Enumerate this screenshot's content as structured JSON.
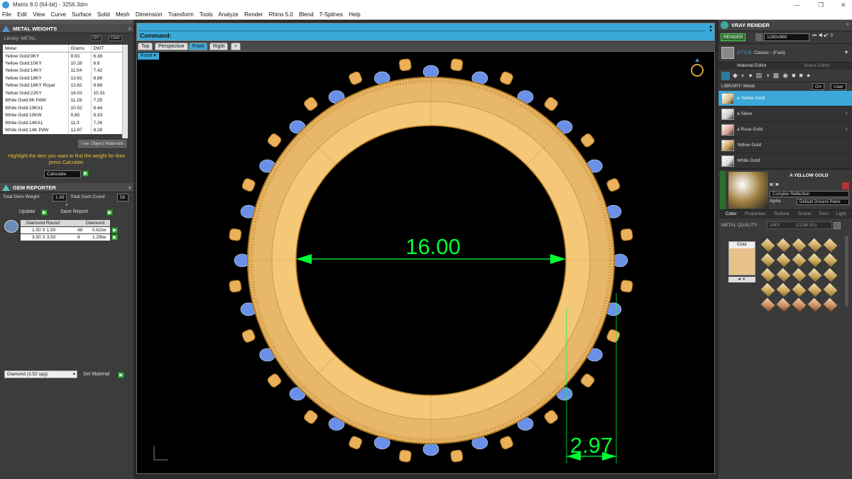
{
  "window": {
    "title": "Matrix 8.0 (64-bit) - 3256.3dm"
  },
  "menu": [
    "File",
    "Edit",
    "View",
    "Curve",
    "Surface",
    "Solid",
    "Mesh",
    "Dimension",
    "Transform",
    "Tools",
    "Analyze",
    "Render",
    "Rhino 5.0",
    "Blend",
    "T-Splines",
    "Help"
  ],
  "metal_weights": {
    "title": "METAL WEIGHTS",
    "library": "Library: METAL",
    "gv": "GV",
    "user": "User",
    "columns": [
      "Metal",
      "Grams",
      "DWT"
    ],
    "rows": [
      [
        "Yellow Gold:9KY",
        "9.93",
        "6.38"
      ],
      [
        "Yellow Gold:10KY",
        "10.26",
        "6.6"
      ],
      [
        "Yellow Gold:14KY",
        "11.54",
        "7.42"
      ],
      [
        "Yellow Gold:18KY",
        "13.81",
        "8.88"
      ],
      [
        "Yellow Gold:18KY Royal",
        "13.81",
        "8.88"
      ],
      [
        "Yellow Gold:22KY",
        "16.03",
        "10.31"
      ],
      [
        "White Gold:9K PdW",
        "11.28",
        "7.25"
      ],
      [
        "White Gold:10KX1",
        "10.02",
        "6.44"
      ],
      [
        "White Gold:10KW",
        "9.85",
        "6.33"
      ],
      [
        "White Gold:14KX1",
        "11.3",
        "7.26"
      ],
      [
        "White Gold:14K PdW",
        "12.87",
        "8.28"
      ]
    ],
    "use_object_materials": "Use Object Materials",
    "hint": "Highlight the item you want to find the weight for then press Calculate.",
    "calculate": "Calculate"
  },
  "gem_reporter": {
    "title": "GEM REPORTER",
    "total_weight_label": "Total Gem Weight",
    "total_weight": "1.89",
    "total_count_label": "Total Gem Count",
    "total_count": "56",
    "update": "Update",
    "save_report": "Save Report",
    "header": [
      "Diamond Round",
      "Diamond"
    ],
    "rows": [
      [
        "1.50 X 1.50",
        "48",
        "0.61tw"
      ],
      [
        "3.50 X 3.50",
        "8",
        "1.29tw"
      ]
    ],
    "material_select": "Diamond   (3.52 spg)",
    "set_material": "Set Material"
  },
  "command": {
    "label": "Command:"
  },
  "view_tabs": [
    "Top",
    "Perspective",
    "Front",
    "Right"
  ],
  "active_tab": "Front",
  "viewport": {
    "label": "Front",
    "dim_inner": "16.00",
    "dim_width": "2.97"
  },
  "vray": {
    "title": "VRAY RENDER",
    "render": "RENDER",
    "resolution": "1280x960",
    "style_label": "STYLE:",
    "style_value": "Classic - (Fast)",
    "tabs": [
      "Material Editor",
      "Scene Editor"
    ],
    "library": "LIBRARY: Metal",
    "materials": [
      "a Yellow Gold",
      "a Silver",
      "a Rose Gold",
      "Yellow Gold",
      "White Gold"
    ],
    "selected_material": "A YELLOW GOLD",
    "reflection": "Complex Reflection",
    "alpha": "Alpha",
    "ground": "Default Ground Plane",
    "subtabs": [
      "Color",
      "Properties",
      "Texture",
      "Scene",
      "Toon",
      "Light"
    ],
    "metal_quality_label": "METAL QUALITY:",
    "metal_quality": "14KY",
    "metal_sg": "(12.88 SG)",
    "color_label": "Color"
  }
}
